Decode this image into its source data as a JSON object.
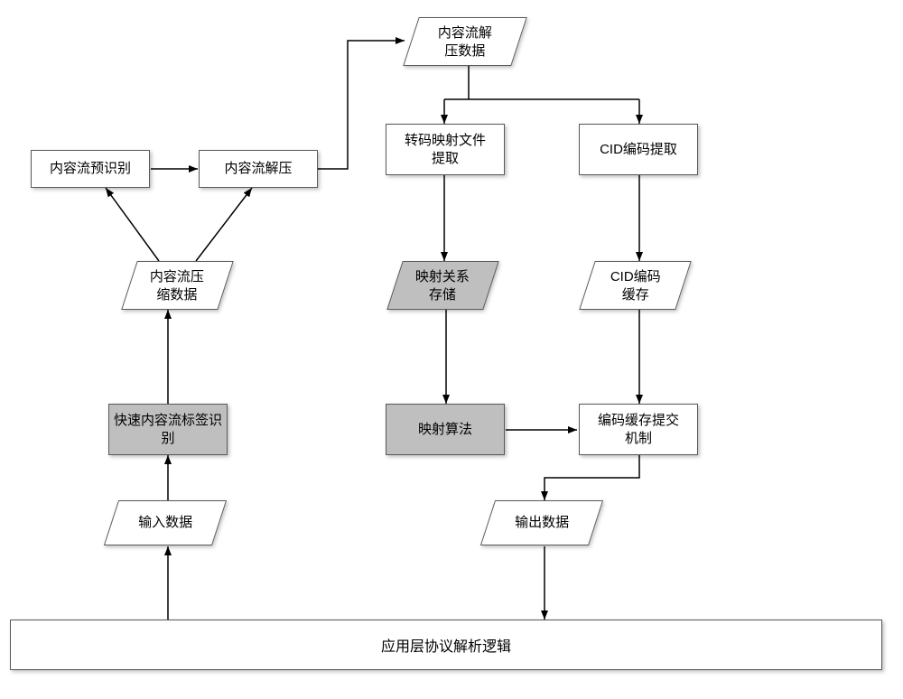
{
  "nodes": {
    "content_decompressed_data": "内容流解\n压数据",
    "content_pre_recognition": "内容流预识别",
    "content_decompress": "内容流解压",
    "content_compressed_data": "内容流压\n缩数据",
    "transcode_map_file_extract": "转码映射文件\n提取",
    "cid_encode_extract": "CID编码提取",
    "mapping_store": "映射关系\n存储",
    "cid_cache": "CID编码\n缓存",
    "fast_content_tag_recognition": "快速内容流标签识\n别",
    "mapping_algorithm": "映射算法",
    "encode_cache_commit": "编码缓存提交\n机制",
    "input_data": "输入数据",
    "output_data": "输出数据",
    "app_layer_protocol_logic": "应用层协议解析逻辑"
  }
}
